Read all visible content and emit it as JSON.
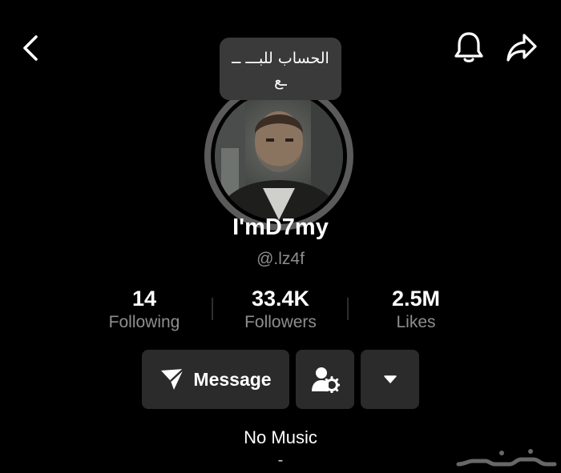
{
  "header": {
    "back_icon": "chevron-left-icon",
    "bell_icon": "bell-icon",
    "share_icon": "share-arrow-icon"
  },
  "sticker": {
    "text": "الحساب للبـــ ـــع"
  },
  "profile": {
    "display_name": "I'mD7my",
    "handle": "@.lz4f"
  },
  "stats": {
    "following": {
      "value": "14",
      "label": "Following"
    },
    "followers": {
      "value": "33.4K",
      "label": "Followers"
    },
    "likes": {
      "value": "2.5M",
      "label": "Likes"
    }
  },
  "actions": {
    "message_label": "Message",
    "message_icon": "send-icon",
    "settings_icon": "user-settings-icon",
    "more_icon": "caret-down-icon"
  },
  "music": {
    "title": "No Music",
    "subtitle": "-"
  },
  "colors": {
    "background": "#000000",
    "button_bg": "#2b2b2b",
    "muted_text": "#8e8e8e",
    "sticker_bg": "#3a3a3a",
    "avatar_ring": "#5b5b5b"
  }
}
